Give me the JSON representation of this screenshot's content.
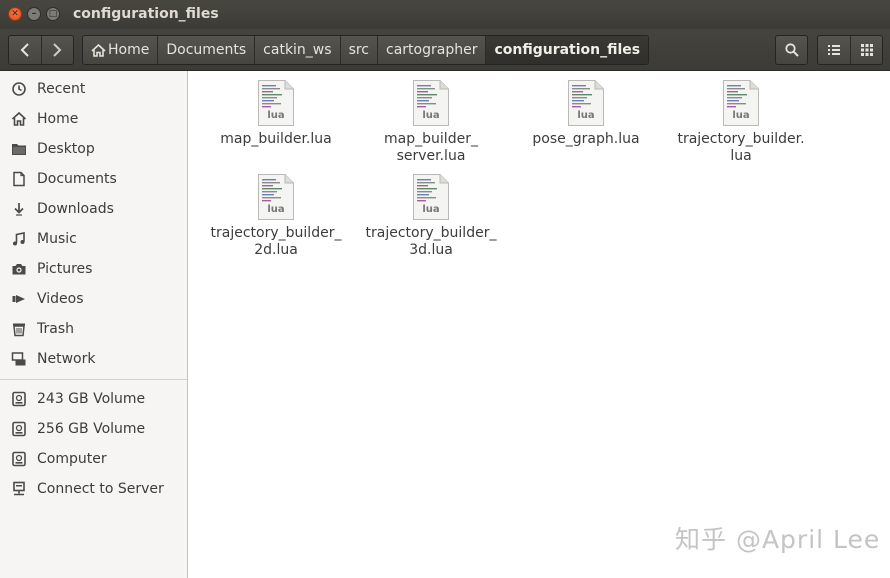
{
  "window": {
    "title": "configuration_files"
  },
  "toolbar": {
    "breadcrumbs": [
      "Home",
      "Documents",
      "catkin_ws",
      "src",
      "cartographer",
      "configuration_files"
    ]
  },
  "sidebar": {
    "places": [
      {
        "label": "Recent",
        "icon": "clock-icon"
      },
      {
        "label": "Home",
        "icon": "home-icon"
      },
      {
        "label": "Desktop",
        "icon": "folder-icon"
      },
      {
        "label": "Documents",
        "icon": "document-icon"
      },
      {
        "label": "Downloads",
        "icon": "download-icon"
      },
      {
        "label": "Music",
        "icon": "music-icon"
      },
      {
        "label": "Pictures",
        "icon": "camera-icon"
      },
      {
        "label": "Videos",
        "icon": "video-icon"
      },
      {
        "label": "Trash",
        "icon": "trash-icon"
      },
      {
        "label": "Network",
        "icon": "network-icon"
      }
    ],
    "devices": [
      {
        "label": "243 GB Volume",
        "icon": "drive-icon"
      },
      {
        "label": "256 GB Volume",
        "icon": "drive-icon"
      },
      {
        "label": "Computer",
        "icon": "drive-icon"
      },
      {
        "label": "Connect to Server",
        "icon": "server-icon"
      }
    ]
  },
  "files": [
    {
      "name_lines": [
        "map_builder.lua"
      ],
      "badge": "lua"
    },
    {
      "name_lines": [
        "map_builder_",
        "server.lua"
      ],
      "badge": "lua"
    },
    {
      "name_lines": [
        "pose_graph.lua"
      ],
      "badge": "lua"
    },
    {
      "name_lines": [
        "trajectory_builder.",
        "lua"
      ],
      "badge": "lua"
    },
    {
      "name_lines": [
        "trajectory_builder_",
        "2d.lua"
      ],
      "badge": "lua"
    },
    {
      "name_lines": [
        "trajectory_builder_",
        "3d.lua"
      ],
      "badge": "lua"
    }
  ],
  "watermark": "知乎 @April Lee"
}
